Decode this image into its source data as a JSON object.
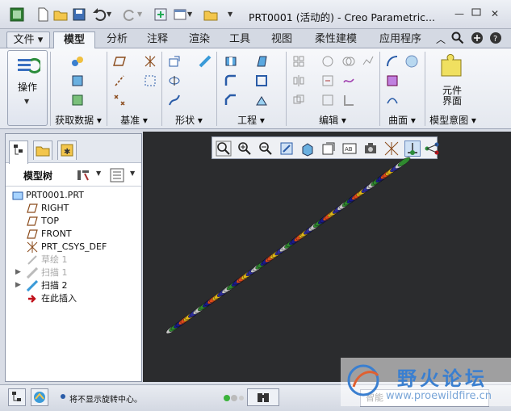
{
  "window": {
    "title": "PRT0001 (活动的) - Creo Parametric...",
    "controls": [
      "minimize-icon",
      "restore-icon",
      "close-icon"
    ]
  },
  "quick_access": [
    "app-icon",
    "new-icon",
    "open-icon",
    "save-icon",
    "undo-icon",
    "redo-icon",
    "regenerate-icon",
    "windows-icon",
    "folder-icon",
    "customize-icon"
  ],
  "tabs": [
    {
      "label": "文件 ▾",
      "active": false
    },
    {
      "label": "模型",
      "active": true
    },
    {
      "label": "分析",
      "active": false
    },
    {
      "label": "注释",
      "active": false
    },
    {
      "label": "渲染",
      "active": false
    },
    {
      "label": "工具",
      "active": false
    },
    {
      "label": "视图",
      "active": false
    },
    {
      "label": "柔性建模",
      "active": false
    },
    {
      "label": "应用程序",
      "active": false
    }
  ],
  "ribbon": {
    "operate_label": "操作",
    "groups": [
      {
        "label": "获取数据 ▾"
      },
      {
        "label": "基准 ▾"
      },
      {
        "label": "形状 ▾"
      },
      {
        "label": "工程 ▾"
      },
      {
        "label": "编辑 ▾"
      },
      {
        "label": "曲面 ▾"
      },
      {
        "label": "模型意图 ▾"
      }
    ],
    "component_interface_label": "元件\n界面",
    "component_interface_line1": "元件",
    "component_interface_line2": "界面"
  },
  "panel": {
    "tree_label": "模型树",
    "tree": [
      {
        "label": "PRT0001.PRT",
        "icon": "part-icon",
        "dim": false
      },
      {
        "label": "RIGHT",
        "icon": "plane-icon",
        "dim": false
      },
      {
        "label": "TOP",
        "icon": "plane-icon",
        "dim": false
      },
      {
        "label": "FRONT",
        "icon": "plane-icon",
        "dim": false
      },
      {
        "label": "PRT_CSYS_DEF",
        "icon": "csys-icon",
        "dim": false
      },
      {
        "label": "草绘 1",
        "icon": "sketch-icon",
        "dim": true
      },
      {
        "label": "扫描 1",
        "icon": "sweep-icon",
        "dim": true
      },
      {
        "label": "扫描 2",
        "icon": "sweep-icon",
        "dim": false
      },
      {
        "label": "在此插入",
        "icon": "insert-arrow-icon",
        "dim": false
      }
    ]
  },
  "status": {
    "message": "将不显示旋转中心。",
    "filter_value": "智能"
  },
  "watermark": {
    "title": "野火论坛",
    "url": "www.proewildfire.cn"
  },
  "colors": {
    "viewport_bg": "#2b2c2e",
    "helix_colors": [
      "#c8c8c8",
      "#2f8a2f",
      "#1a1a8a",
      "#e04a1a",
      "#e0b81a",
      "#2e2e9e"
    ]
  }
}
